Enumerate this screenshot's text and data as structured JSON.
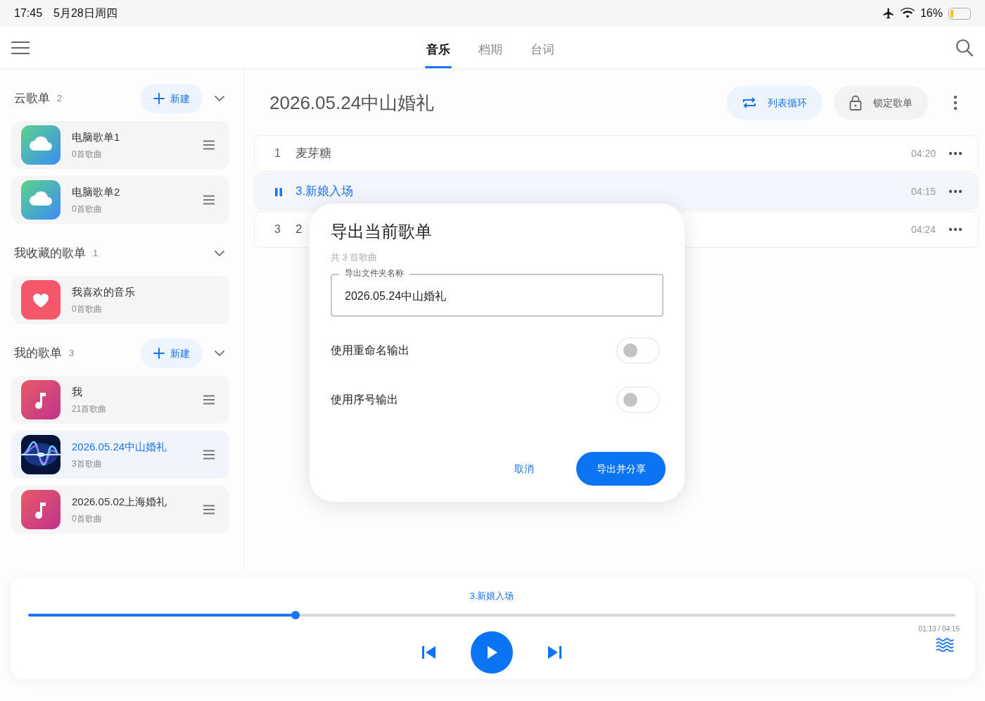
{
  "status_bar": {
    "time": "17:45",
    "date": "5月28日周四",
    "battery_text": "16%",
    "battery": {
      "level": 0.16
    }
  },
  "tabs": [
    {
      "label": "音乐",
      "selected": true
    },
    {
      "label": "档期",
      "selected": false
    },
    {
      "label": "台词",
      "selected": false
    }
  ],
  "sidebar": {
    "sections": [
      {
        "title": "云歌单",
        "count": "2",
        "new_button": "新建",
        "expanded": true,
        "items": [
          {
            "kind": "cloud",
            "name": "电脑歌单1",
            "subtitle": "0首歌曲",
            "selected": false,
            "handle": true
          },
          {
            "kind": "cloud",
            "name": "电脑歌单2",
            "subtitle": "0首歌曲",
            "selected": false,
            "handle": true
          }
        ]
      },
      {
        "title": "我收藏的歌单",
        "count": "1",
        "expanded": true,
        "items": [
          {
            "kind": "heart",
            "name": "我喜欢的音乐",
            "subtitle": "0首歌曲",
            "selected": false,
            "handle": false
          }
        ]
      },
      {
        "title": "我的歌单",
        "count": "3",
        "new_button": "新建",
        "expanded": true,
        "items": [
          {
            "kind": "note",
            "name": "我",
            "subtitle": "21首歌曲",
            "selected": false,
            "handle": true
          },
          {
            "kind": "picture",
            "name": "2026.05.24中山婚礼",
            "subtitle": "3首歌曲",
            "selected": true,
            "handle": true
          },
          {
            "kind": "note",
            "name": "2026.05.02上海婚礼",
            "subtitle": "0首歌曲",
            "selected": false,
            "handle": true
          }
        ]
      }
    ]
  },
  "playlist": {
    "title": "2026.05.24中山婚礼",
    "buttons": [
      {
        "kind": "repeat",
        "label": "列表循环"
      },
      {
        "kind": "lock",
        "label": "锁定歌单"
      }
    ],
    "tracks": [
      {
        "number": "1",
        "title": "麦芽糖",
        "duration": "04:20",
        "playing": false
      },
      {
        "title": "3.新娘入场",
        "duration": "04:15",
        "playing": true
      },
      {
        "number": "3",
        "title": "2",
        "duration": "04:24",
        "playing": false
      }
    ]
  },
  "dialog": {
    "title": "导出当前歌单",
    "subtitle": "共 3 首歌曲",
    "field": {
      "label": "导出文件夹名称",
      "value": "2026.05.24中山婚礼"
    },
    "toggles": [
      {
        "label": "使用重命名输出",
        "checked": false
      },
      {
        "label": "使用序号输出",
        "checked": false
      }
    ],
    "cancel": "取消",
    "confirm": "导出并分享"
  },
  "player": {
    "title": "3.新娘入场",
    "level": 0.288,
    "time": "01:13 / 04:15",
    "playing": false
  }
}
